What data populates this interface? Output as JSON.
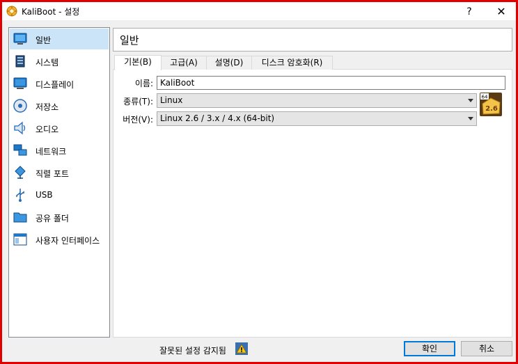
{
  "window": {
    "title": "KaliBoot - 설정",
    "help_label": "?",
    "close_label": "✕"
  },
  "sidebar": {
    "items": [
      {
        "label": "일반",
        "icon": "general-icon",
        "selected": true
      },
      {
        "label": "시스템",
        "icon": "system-icon"
      },
      {
        "label": "디스플레이",
        "icon": "display-icon"
      },
      {
        "label": "저장소",
        "icon": "storage-icon"
      },
      {
        "label": "오디오",
        "icon": "audio-icon"
      },
      {
        "label": "네트워크",
        "icon": "network-icon"
      },
      {
        "label": "직렬 포트",
        "icon": "serial-port-icon"
      },
      {
        "label": "USB",
        "icon": "usb-icon"
      },
      {
        "label": "공유 폴더",
        "icon": "shared-folder-icon"
      },
      {
        "label": "사용자 인터페이스",
        "icon": "user-interface-icon"
      }
    ]
  },
  "main": {
    "page_title": "일반",
    "tabs": [
      {
        "label": "기본(B)",
        "active": true
      },
      {
        "label": "고급(A)"
      },
      {
        "label": "설명(D)"
      },
      {
        "label": "디스크 암호화(R)"
      }
    ],
    "form": {
      "name_label": "이름:",
      "name_value": "KaliBoot",
      "type_label": "종류(T):",
      "type_value": "Linux",
      "version_label": "버전(V):",
      "version_value": "Linux 2.6 / 3.x / 4.x (64-bit)",
      "os_badge_text": "2.6",
      "os_badge_bits": "64"
    }
  },
  "footer": {
    "warning_text": "잘못된 설정 감지됨",
    "ok_label": "확인",
    "cancel_label": "취소"
  },
  "colors": {
    "frame": "#e00000",
    "selected_bg": "#cce4f7",
    "default_button_border": "#0078d7"
  }
}
